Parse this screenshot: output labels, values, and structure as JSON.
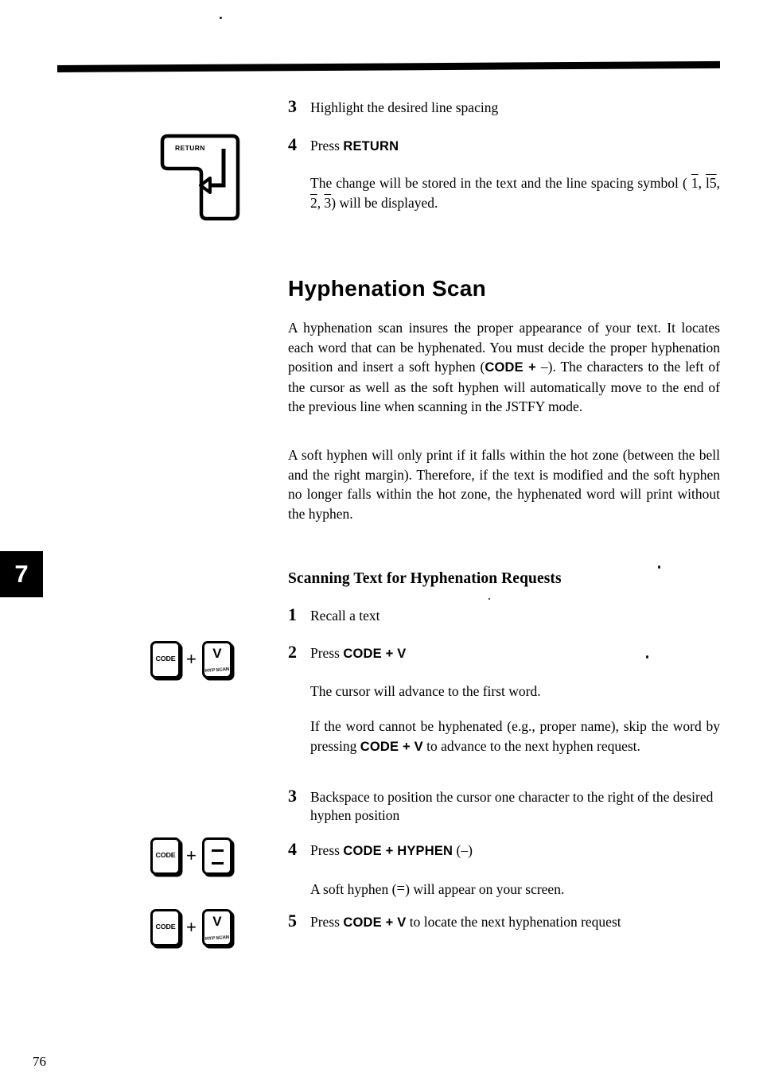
{
  "page": {
    "number": "76",
    "chapter_tab": "7"
  },
  "top_steps": [
    {
      "num": "3",
      "text": "Highlight the desired line spacing"
    },
    {
      "num": "4",
      "text_prefix": "Press ",
      "text_bold": "RETURN"
    }
  ],
  "return_note": {
    "line1": "The change will be stored in the text and the line spacing",
    "line2_prefix": "symbol ( ",
    "symbols": [
      "1",
      "l5",
      "2",
      "3"
    ],
    "line2_suffix": ") will be displayed."
  },
  "return_key": {
    "label": "RETURN"
  },
  "section": {
    "heading": "Hyphenation Scan",
    "para1_a": "A hyphenation scan insures the proper appearance of your text. It locates each word that can be hyphenated. You must decide the proper hyphenation position and insert a soft hyphen (",
    "para1_code": "CODE +",
    "para1_b": "–). The characters to the left of the cursor as well as the soft hyphen will automatically move to the end of the previous line when scanning in the JSTFY mode.",
    "para2": "A soft hyphen will only print if it falls within the hot zone (between the bell and the right margin). Therefore, if the text is modified and the soft hyphen no longer falls within the hot zone, the hyphenated word will print without the hyphen."
  },
  "subsection": {
    "heading": "Scanning Text for Hyphenation Requests"
  },
  "steps": [
    {
      "num": "1",
      "text": "Recall a text"
    },
    {
      "num": "2",
      "prefix": "Press ",
      "bold": "CODE + V"
    },
    {
      "num": "3",
      "text": "Backspace to position the cursor one character to the right of the desired hyphen position"
    },
    {
      "num": "4",
      "prefix": "Press ",
      "bold": "CODE + HYPHEN",
      "suffix": " (–)"
    },
    {
      "num": "5",
      "prefix": "Press ",
      "bold": "CODE + V",
      "suffix": " to locate the next hyphenation request"
    }
  ],
  "notes": {
    "after_step2": "The cursor will advance to the first word.",
    "skip_a": "If the word cannot be hyphenated (e.g., proper name), skip the word by pressing ",
    "skip_bold": "CODE + V",
    "skip_b": " to advance to the next hyphen request.",
    "after_step4_a": "A soft hyphen (",
    "after_step4_sym": "=",
    "after_step4_b": ") will appear on your screen."
  },
  "keys": {
    "code_label": "CODE",
    "v_main": "V",
    "v_sub": "HYP SCAN",
    "plus": "+",
    "hyphen_name": "hyphen-key"
  },
  "colors": {
    "ink": "#000000",
    "paper": "#ffffff"
  }
}
